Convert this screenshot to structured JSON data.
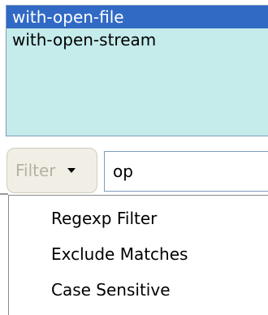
{
  "completion_list": {
    "items": [
      {
        "label": "with-open-file",
        "selected": true
      },
      {
        "label": "with-open-stream",
        "selected": false
      }
    ]
  },
  "filter": {
    "button_label": "Filter",
    "arrow_icon": "chevron-down-icon",
    "input_value": "op"
  },
  "menu": {
    "items": [
      {
        "label": "Regexp Filter"
      },
      {
        "label": "Exclude Matches"
      },
      {
        "label": "Case Sensitive"
      }
    ]
  },
  "colors": {
    "list_background": "#c5ebeb",
    "selection": "#316ac5",
    "disabled_text": "#b3b1a4"
  }
}
